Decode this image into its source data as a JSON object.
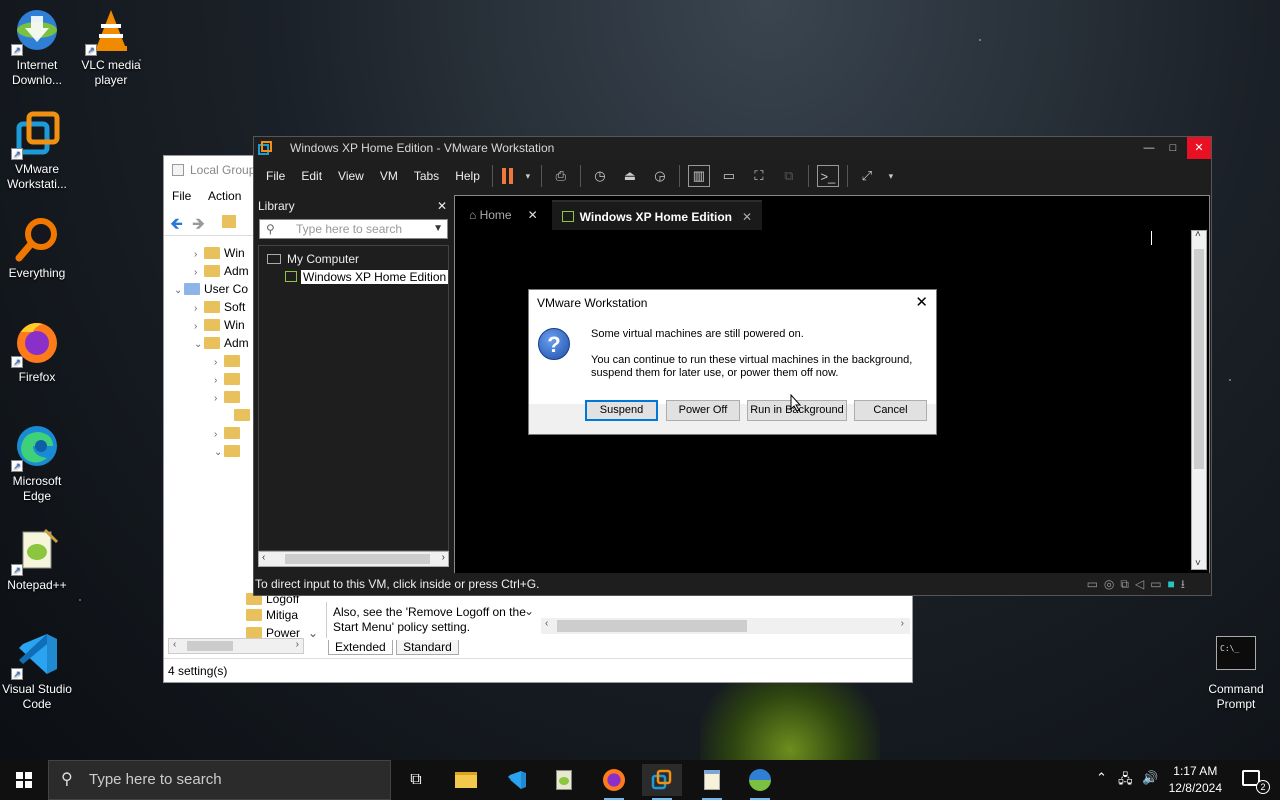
{
  "desktop": {
    "icons_left": [
      {
        "label": "Internet Downlo...",
        "icon": "idm-icon"
      },
      {
        "label": "VLC media player",
        "icon": "vlc-icon"
      },
      {
        "label": "VMware Workstati...",
        "icon": "vmware-icon"
      },
      {
        "label": "Everything",
        "icon": "everything-icon"
      },
      {
        "label": "Firefox",
        "icon": "firefox-icon"
      },
      {
        "label": "Microsoft Edge",
        "icon": "edge-icon"
      },
      {
        "label": "Notepad++",
        "icon": "notepadpp-icon"
      },
      {
        "label": "Visual Studio Code",
        "icon": "vscode-icon"
      }
    ],
    "icon_right": {
      "label": "Command Prompt",
      "glyph": "C:\\_"
    }
  },
  "gpe": {
    "title": "Local Group",
    "menu": [
      "File",
      "Action"
    ],
    "tree": [
      "Win",
      "Adm",
      "User Co",
      "Soft",
      "Win",
      "Adm"
    ],
    "bottom_items": [
      "Logoff",
      "Mitiga",
      "Power"
    ],
    "description": "Also, see the 'Remove Logoff on the Start Menu' policy setting.",
    "tabs": [
      "Extended",
      "Standard"
    ],
    "status": "4 setting(s)"
  },
  "vmware": {
    "title": "Windows XP Home Edition - VMware Workstation",
    "menu": [
      "File",
      "Edit",
      "View",
      "VM",
      "Tabs",
      "Help"
    ],
    "library": {
      "header": "Library",
      "search_placeholder": "Type here to search",
      "tree": [
        "My Computer",
        "Windows XP Home Edition"
      ]
    },
    "tabs": [
      "Home",
      "Windows XP Home Edition"
    ],
    "status_text": "To direct input to this VM, click inside or press Ctrl+G."
  },
  "dialog": {
    "title": "VMware Workstation",
    "message1": "Some virtual machines are still powered on.",
    "message2": "You can continue to run these virtual machines in the background, suspend them for later use, or power them off now.",
    "buttons": [
      "Suspend",
      "Power Off",
      "Run in Background",
      "Cancel"
    ]
  },
  "taskbar": {
    "search_placeholder": "Type here to search",
    "time": "1:17 AM",
    "date": "12/8/2024",
    "notification_count": "2"
  }
}
